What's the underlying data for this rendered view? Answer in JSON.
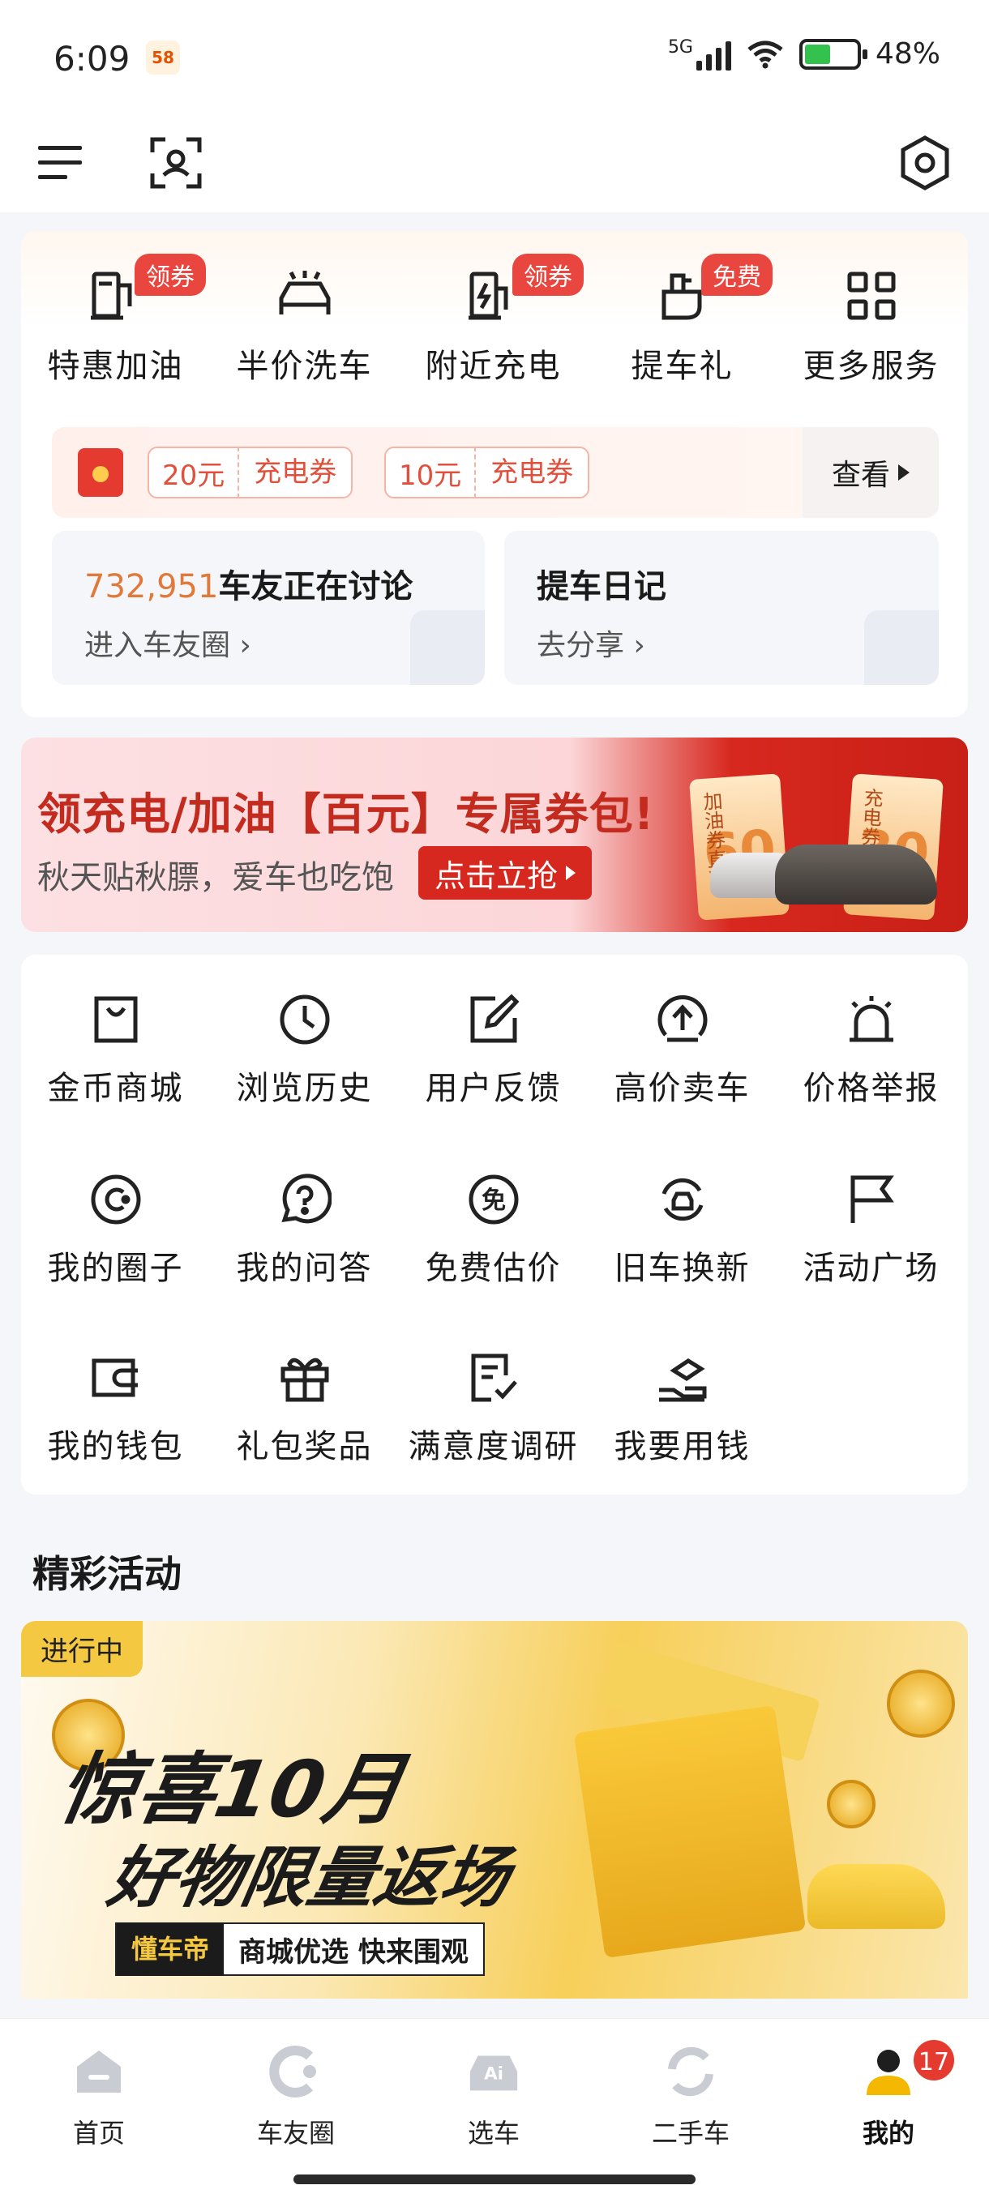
{
  "status_bar": {
    "time": "6:09",
    "app_icon_text": "58",
    "network": "5G",
    "battery": "48%"
  },
  "top_nav": {
    "menu_icon": "menu-icon",
    "scan_icon": "scan-icon",
    "settings_icon": "settings-icon"
  },
  "services": {
    "items": [
      {
        "label": "特惠加油",
        "tag": "领券",
        "icon": "fuel-pump-icon"
      },
      {
        "label": "半价洗车",
        "tag": "",
        "icon": "car-wash-icon"
      },
      {
        "label": "附近充电",
        "tag": "领券",
        "icon": "charging-icon"
      },
      {
        "label": "提车礼",
        "tag": "免费",
        "icon": "gift-bag-icon"
      },
      {
        "label": "更多服务",
        "tag": "",
        "icon": "grid-icon"
      }
    ],
    "coupons": [
      {
        "amount": "20元",
        "type": "充电券"
      },
      {
        "amount": "10元",
        "type": "充电券"
      }
    ],
    "view_label": "查看",
    "community": {
      "count": "732,951",
      "title": "车友正在讨论",
      "link": "进入车友圈"
    },
    "diary": {
      "title": "提车日记",
      "link": "去分享"
    }
  },
  "banner": {
    "title": "领充电/加油【百元】专属券包!",
    "subtitle": "秋天贴秋膘，爱车也吃饱",
    "button": "点击立抢",
    "ticket1": {
      "label": "加油券直减",
      "value": "60"
    },
    "ticket2": {
      "label": "充电券",
      "value": "30"
    }
  },
  "tools": [
    {
      "label": "金币商城",
      "icon": "shopping-bag-icon"
    },
    {
      "label": "浏览历史",
      "icon": "clock-icon"
    },
    {
      "label": "用户反馈",
      "icon": "edit-icon"
    },
    {
      "label": "高价卖车",
      "icon": "upload-circle-icon"
    },
    {
      "label": "价格举报",
      "icon": "alarm-icon"
    },
    {
      "label": "我的圈子",
      "icon": "circle-c-icon"
    },
    {
      "label": "我的问答",
      "icon": "question-icon"
    },
    {
      "label": "免费估价",
      "icon": "free-badge-icon"
    },
    {
      "label": "旧车换新",
      "icon": "car-exchange-icon"
    },
    {
      "label": "活动广场",
      "icon": "flag-icon"
    },
    {
      "label": "我的钱包",
      "icon": "wallet-icon"
    },
    {
      "label": "礼包奖品",
      "icon": "gift-icon"
    },
    {
      "label": "满意度调研",
      "icon": "survey-icon"
    },
    {
      "label": "我要用钱",
      "icon": "hand-coin-icon"
    }
  ],
  "activities": {
    "title": "精彩活动",
    "badge": "进行中",
    "headline1": "惊喜10月",
    "headline2": "好物限量返场",
    "brand": "懂车帝",
    "tagline": "商城优选 快来围观"
  },
  "bottom_nav": {
    "items": [
      {
        "label": "首页",
        "icon": "home-icon"
      },
      {
        "label": "车友圈",
        "icon": "community-icon"
      },
      {
        "label": "选车",
        "icon": "car-select-icon"
      },
      {
        "label": "二手车",
        "icon": "recycle-icon"
      },
      {
        "label": "我的",
        "icon": "profile-icon"
      }
    ],
    "badge": "17"
  }
}
